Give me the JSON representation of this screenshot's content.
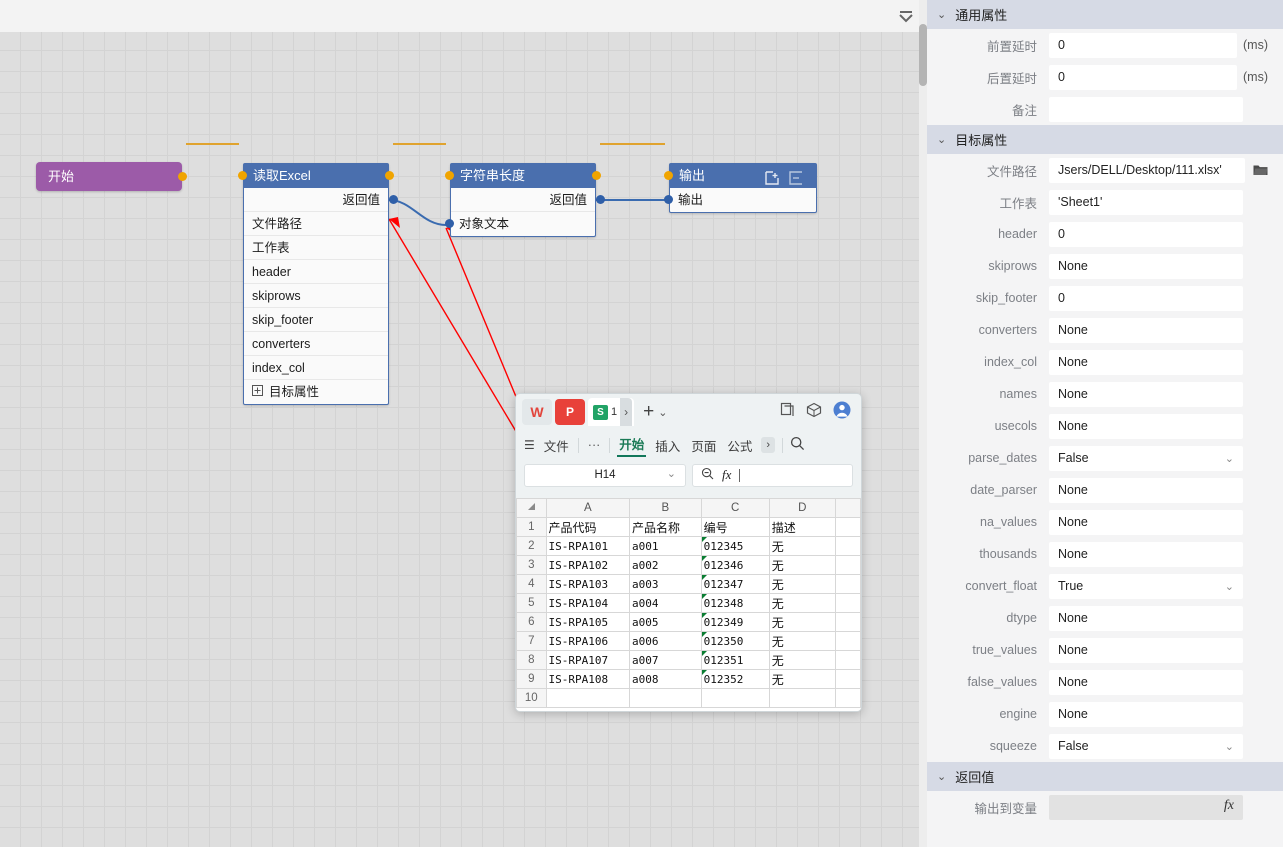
{
  "topbar": {
    "collapse_icon": "collapse-all-icon"
  },
  "flow": {
    "nodes": [
      {
        "id": "start",
        "title": "开始",
        "color": "#9c5ba8",
        "rows": []
      },
      {
        "id": "read-excel",
        "title": "读取Excel",
        "color": "#4a6fae",
        "rows": [
          "返回值",
          "文件路径",
          "工作表",
          "header",
          "skiprows",
          "skip_footer",
          "converters",
          "index_col",
          "目标属性"
        ]
      },
      {
        "id": "string-length",
        "title": "字符串长度",
        "color": "#4a6fae",
        "rows": [
          "返回值",
          "对象文本"
        ]
      },
      {
        "id": "output",
        "title": "输出",
        "color": "#4a6fae",
        "rows": [
          "输出"
        ],
        "icons": [
          "add-node-icon",
          "collapse-node-icon"
        ]
      }
    ]
  },
  "wps": {
    "app_chips": [
      "wps-writer-icon",
      "wps-pdf-icon"
    ],
    "doc_tab": {
      "icon": "wps-spreadsheet-icon",
      "label": "1",
      "more": "›"
    },
    "new_tab": "+",
    "new_tab_chevron": "⌄",
    "window_icons": [
      "copy-icon",
      "cube-icon",
      "account-icon"
    ],
    "menu": {
      "hamburger": "☰",
      "file": "文件",
      "more": "···",
      "items": [
        "开始",
        "插入",
        "页面",
        "公式"
      ],
      "active": "开始",
      "overflow": "›",
      "search": "search-icon"
    },
    "namebox": "H14",
    "namebox_chevron": "⌄",
    "formula_icons": [
      "name-lookup-icon",
      "fx-icon"
    ],
    "formula_value": "",
    "sheet": {
      "columns": [
        "A",
        "B",
        "C",
        "D",
        ""
      ],
      "row_numbers": [
        "1",
        "2",
        "3",
        "4",
        "5",
        "6",
        "7",
        "8",
        "9",
        "10"
      ],
      "rows": [
        [
          "产品代码",
          "产品名称",
          "编号",
          "描述",
          ""
        ],
        [
          "IS-RPA101",
          "a001",
          "012345",
          "无",
          ""
        ],
        [
          "IS-RPA102",
          "a002",
          "012346",
          "无",
          ""
        ],
        [
          "IS-RPA103",
          "a003",
          "012347",
          "无",
          ""
        ],
        [
          "IS-RPA104",
          "a004",
          "012348",
          "无",
          ""
        ],
        [
          "IS-RPA105",
          "a005",
          "012349",
          "无",
          ""
        ],
        [
          "IS-RPA106",
          "a006",
          "012350",
          "无",
          ""
        ],
        [
          "IS-RPA107",
          "a007",
          "012351",
          "无",
          ""
        ],
        [
          "IS-RPA108",
          "a008",
          "012352",
          "无",
          ""
        ],
        [
          "",
          "",
          "",
          "",
          ""
        ]
      ]
    }
  },
  "panel": {
    "sections": [
      {
        "title": "通用属性",
        "fields": [
          {
            "label": "前置延时",
            "value": "0",
            "unit": "(ms)",
            "type": "text"
          },
          {
            "label": "后置延时",
            "value": "0",
            "unit": "(ms)",
            "type": "text"
          },
          {
            "label": "备注",
            "value": "",
            "unit": "",
            "type": "text"
          }
        ]
      },
      {
        "title": "目标属性",
        "fields": [
          {
            "label": "文件路径",
            "value": "Jsers/DELL/Desktop/111.xlsx'",
            "after": "folder-icon",
            "type": "text"
          },
          {
            "label": "工作表",
            "value": "'Sheet1'",
            "type": "text"
          },
          {
            "label": "header",
            "value": "0",
            "type": "text"
          },
          {
            "label": "skiprows",
            "value": "None",
            "type": "text"
          },
          {
            "label": "skip_footer",
            "value": "0",
            "type": "text"
          },
          {
            "label": "converters",
            "value": "None",
            "type": "text"
          },
          {
            "label": "index_col",
            "value": "None",
            "type": "text"
          },
          {
            "label": "names",
            "value": "None",
            "type": "text"
          },
          {
            "label": "usecols",
            "value": "None",
            "type": "text"
          },
          {
            "label": "parse_dates",
            "value": "False",
            "type": "select"
          },
          {
            "label": "date_parser",
            "value": "None",
            "type": "text"
          },
          {
            "label": "na_values",
            "value": "None",
            "type": "text"
          },
          {
            "label": "thousands",
            "value": "None",
            "type": "text"
          },
          {
            "label": "convert_float",
            "value": "True",
            "type": "select"
          },
          {
            "label": "dtype",
            "value": "None",
            "type": "text"
          },
          {
            "label": "true_values",
            "value": "None",
            "type": "text"
          },
          {
            "label": "false_values",
            "value": "None",
            "type": "text"
          },
          {
            "label": "engine",
            "value": "None",
            "type": "text"
          },
          {
            "label": "squeeze",
            "value": "False",
            "type": "select"
          }
        ]
      },
      {
        "title": "返回值",
        "fields": [
          {
            "label": "输出到变量",
            "value": "",
            "type": "readonly",
            "after": "fx-icon"
          }
        ]
      }
    ]
  },
  "colors": {
    "node_header": "#4a6fae",
    "start_node": "#9c5ba8",
    "port_orange": "#f0a400",
    "port_blue": "#2f5fa8",
    "section_header": "#d6dae5",
    "annotation_arrow": "#ff0000"
  }
}
